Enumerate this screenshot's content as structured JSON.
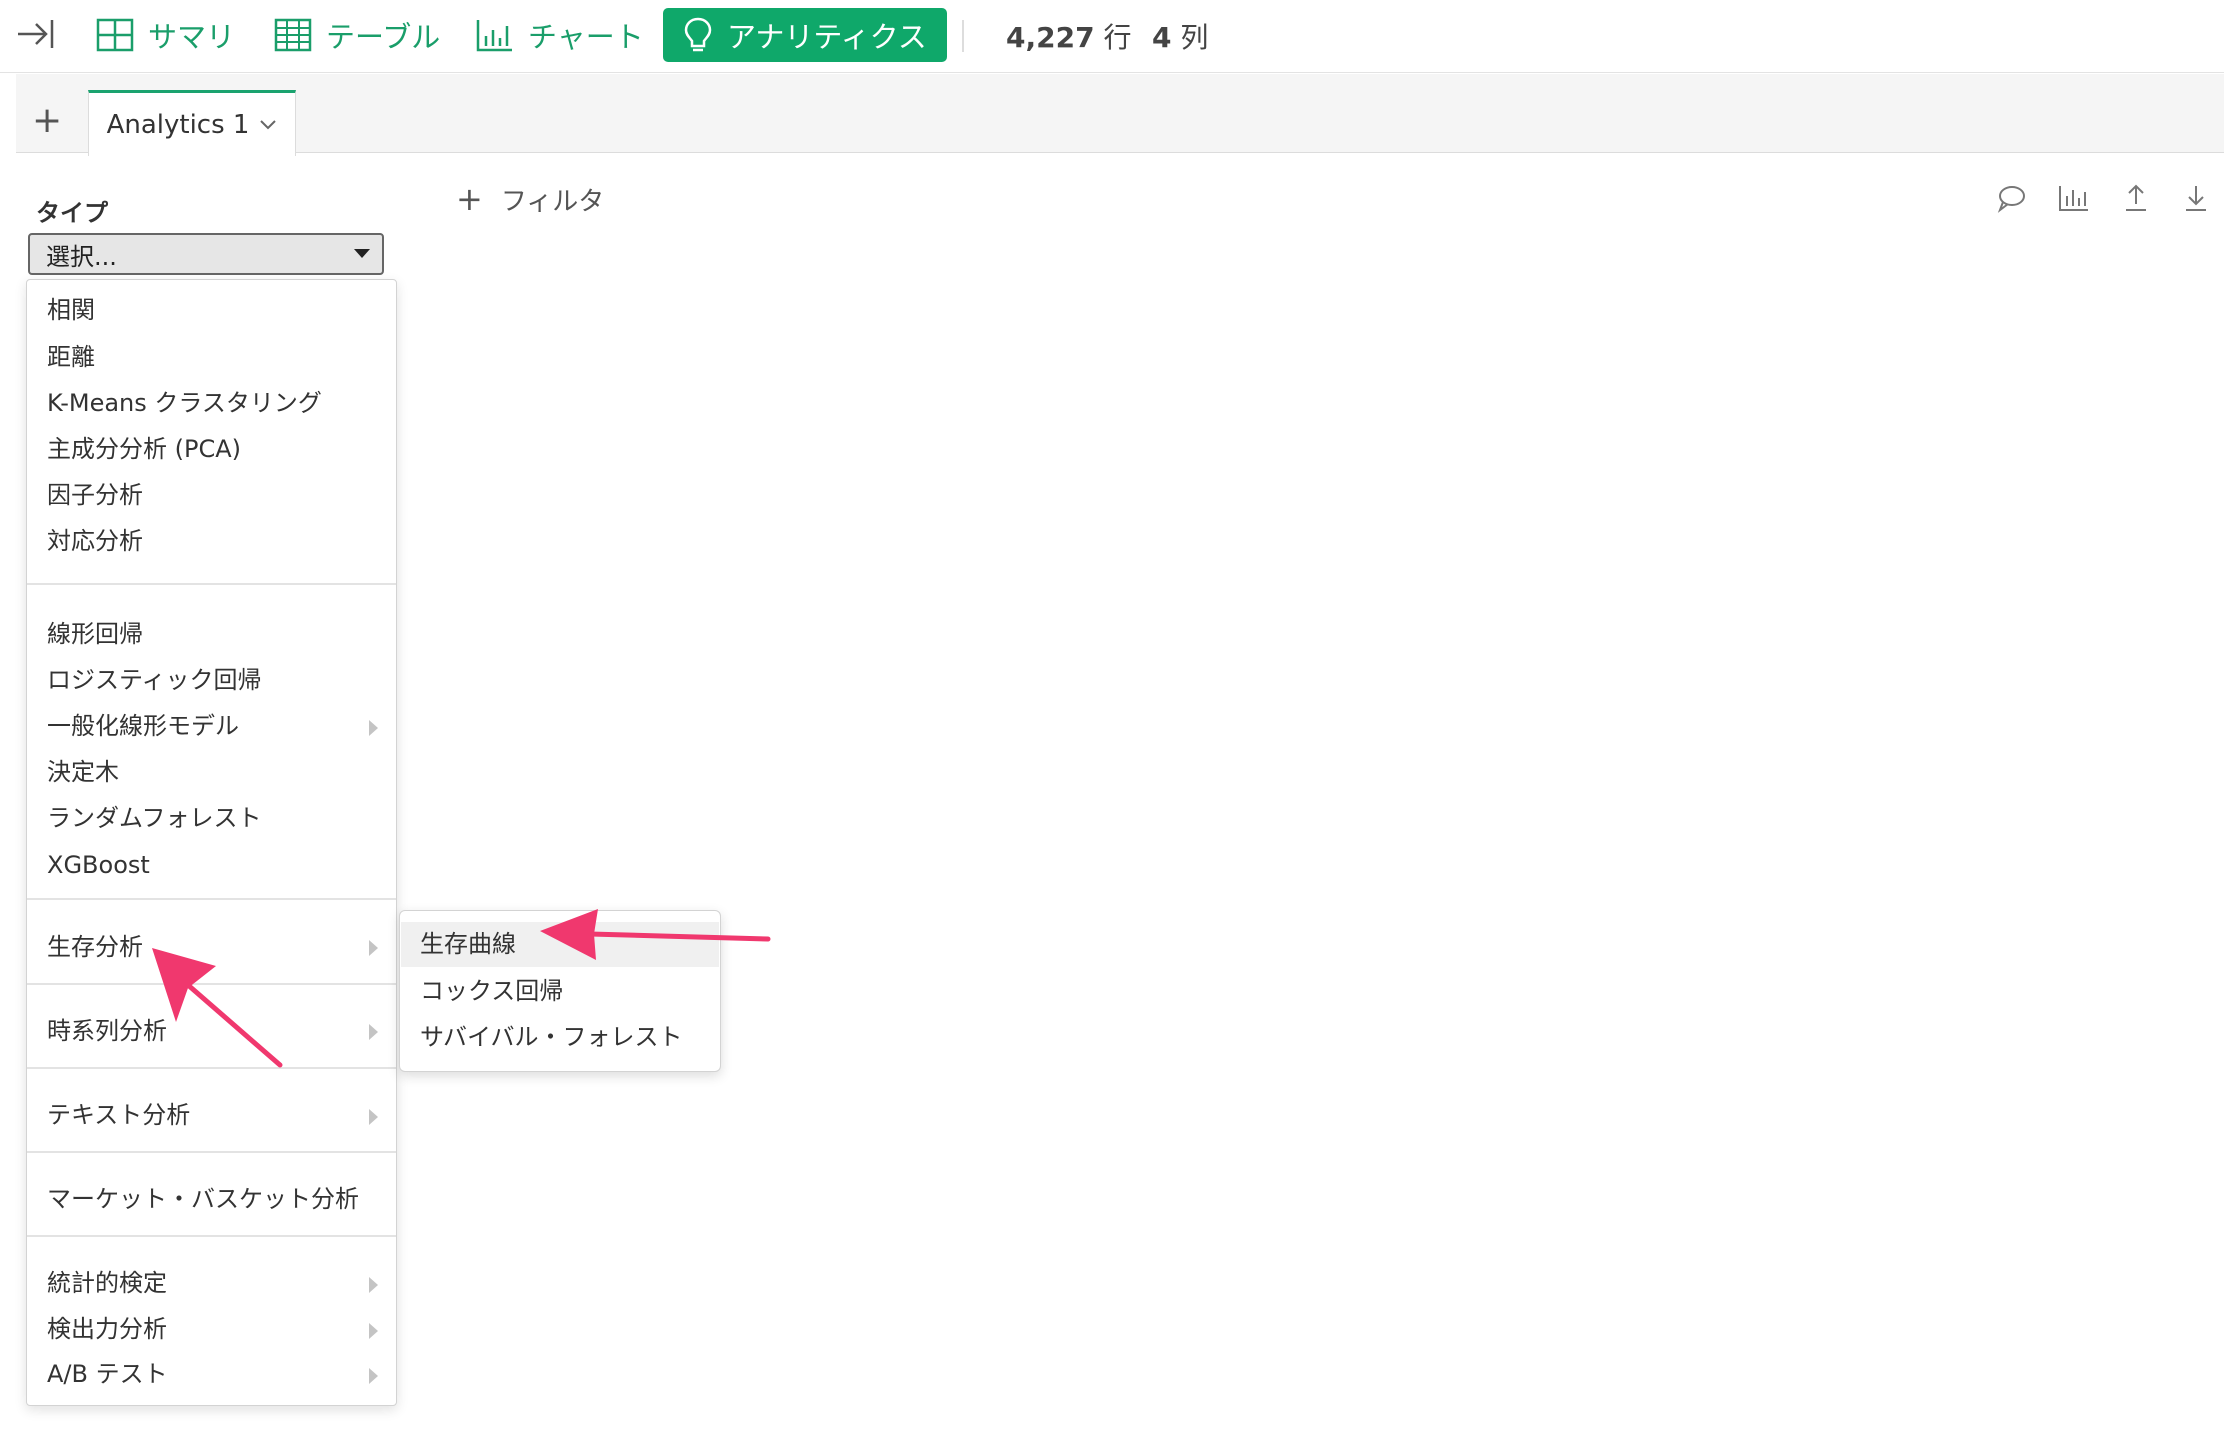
{
  "toolbar": {
    "summary_label": "サマリ",
    "table_label": "テーブル",
    "chart_label": "チャート",
    "analytics_label": "アナリティクス",
    "rows_count": "4,227",
    "rows_unit": "行",
    "cols_count": "4",
    "cols_unit": "列"
  },
  "tabs": {
    "add_label": "+",
    "active_label": "Analytics 1"
  },
  "panel": {
    "type_label": "タイプ",
    "select_value": "選択..."
  },
  "filter": {
    "label": "フィルタ"
  },
  "menu": {
    "groups": [
      [
        "相関",
        "距離",
        "K-Means クラスタリング",
        "主成分分析 (PCA)",
        "因子分析",
        "対応分析"
      ],
      [
        "線形回帰",
        "ロジスティック回帰",
        "一般化線形モデル",
        "決定木",
        "ランダムフォレスト",
        "XGBoost"
      ],
      [
        "生存分析"
      ],
      [
        "時系列分析"
      ],
      [
        "テキスト分析"
      ],
      [
        "マーケット・バスケット分析"
      ],
      [
        "統計的検定",
        "検出力分析",
        "A/B テスト"
      ]
    ]
  },
  "submenu": {
    "items": [
      "生存曲線",
      "コックス回帰",
      "サバイバル・フォレスト"
    ]
  },
  "colors": {
    "accent": "#0fa86a",
    "annotation": "#f0386e"
  }
}
